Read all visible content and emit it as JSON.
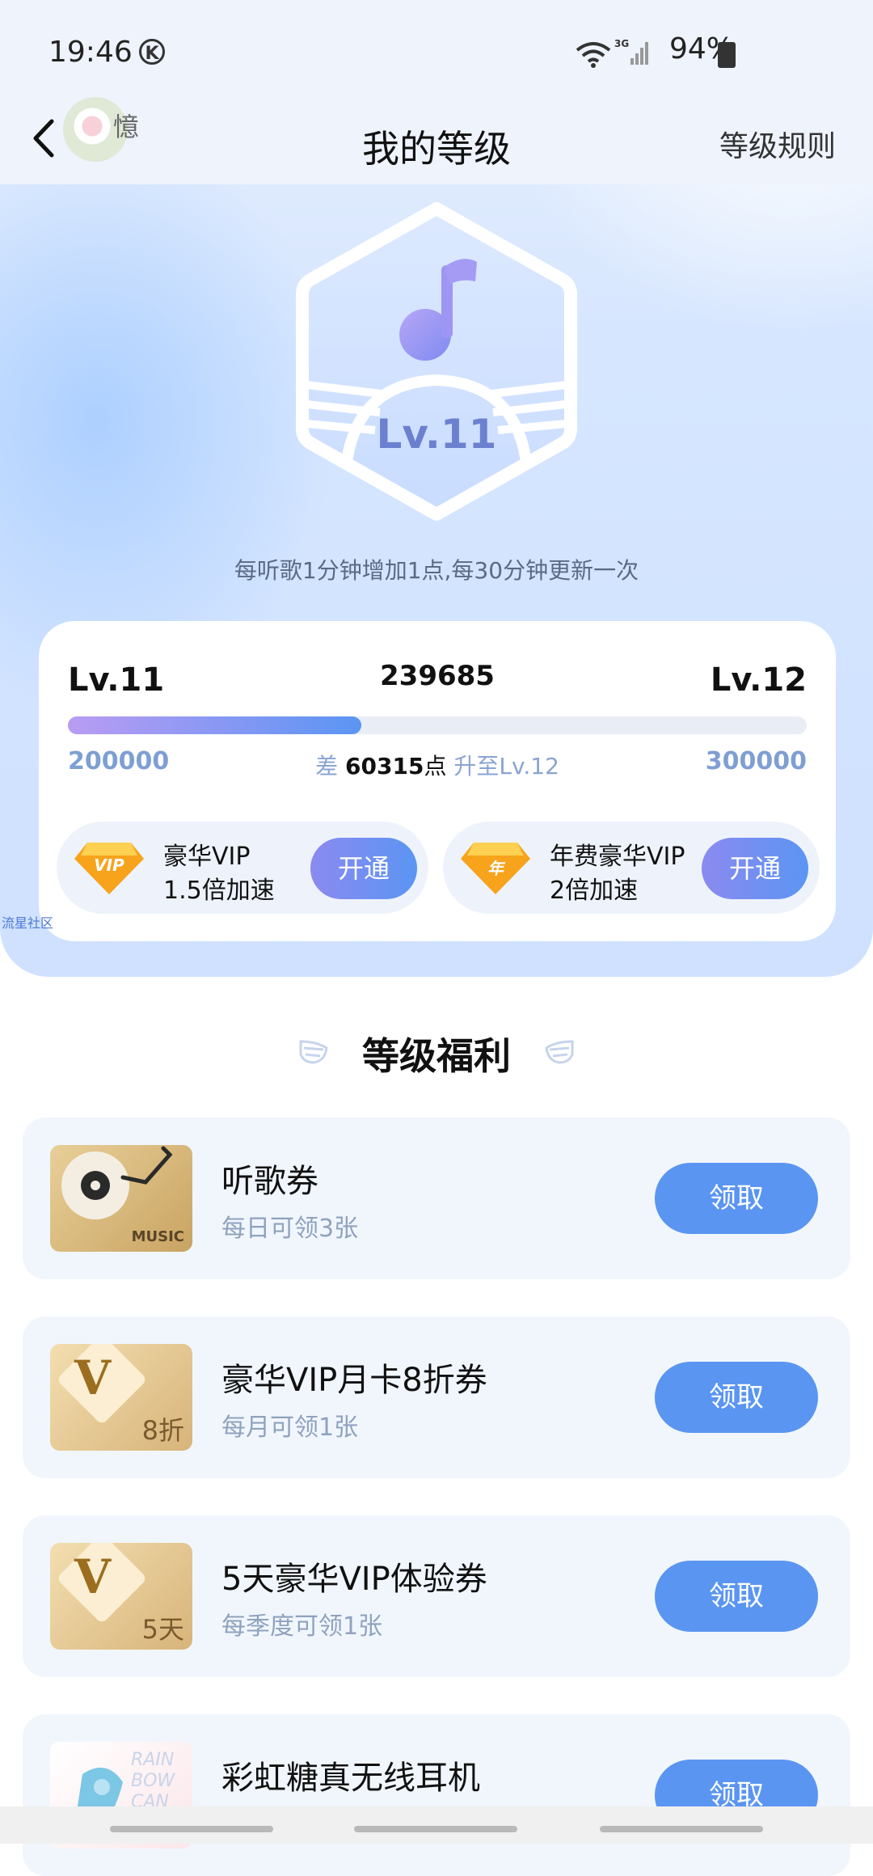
{
  "status": {
    "time": "19:46",
    "k_glyph": "K",
    "network": "3G",
    "battery": "94%"
  },
  "header": {
    "nickname": "憶",
    "title": "我的等级",
    "rules": "等级规则"
  },
  "badge": {
    "level": "Lv.11",
    "tip": "每听歌1分钟增加1点,每30分钟更新一次"
  },
  "progress": {
    "current_level": "Lv.11",
    "next_level": "Lv.12",
    "score": "239685",
    "min": "200000",
    "max": "300000",
    "diff_prefix": "差",
    "diff_value": "60315",
    "diff_unit": "点",
    "diff_suffix": "升至Lv.12",
    "fraction": 0.397
  },
  "vip": [
    {
      "gem_text": "VIP",
      "line1": "豪华VIP",
      "line2": "1.5倍加速",
      "button": "开通"
    },
    {
      "gem_text": "年",
      "line1": "年费豪华VIP",
      "line2": "2倍加速",
      "button": "开通"
    }
  ],
  "watermark": "流星社区",
  "benefits": {
    "title": "等级福利",
    "items": [
      {
        "title": "听歌券",
        "subtitle": "每日可领3张",
        "button": "领取",
        "thumb_label": "MUSIC"
      },
      {
        "title": "豪华VIP月卡8折券",
        "subtitle": "每月可领1张",
        "button": "领取",
        "thumb_letter": "V",
        "thumb_label": "8折"
      },
      {
        "title": "5天豪华VIP体验券",
        "subtitle": "每季度可领1张",
        "button": "领取",
        "thumb_letter": "V",
        "thumb_label": "5天"
      },
      {
        "title": "彩虹糖真无线耳机",
        "subtitle": "",
        "button": "领取",
        "thumb_label": "RAIN BOW CAN"
      }
    ]
  },
  "icons": [
    "back-icon",
    "wifi-icon",
    "signal-icon",
    "battery-icon",
    "music-note-icon",
    "wing-icon"
  ],
  "colors": {
    "accent": "#5a95f1",
    "progress_start": "#b99cf3",
    "progress_end": "#5b95f3",
    "level_text": "#6b80cf"
  }
}
